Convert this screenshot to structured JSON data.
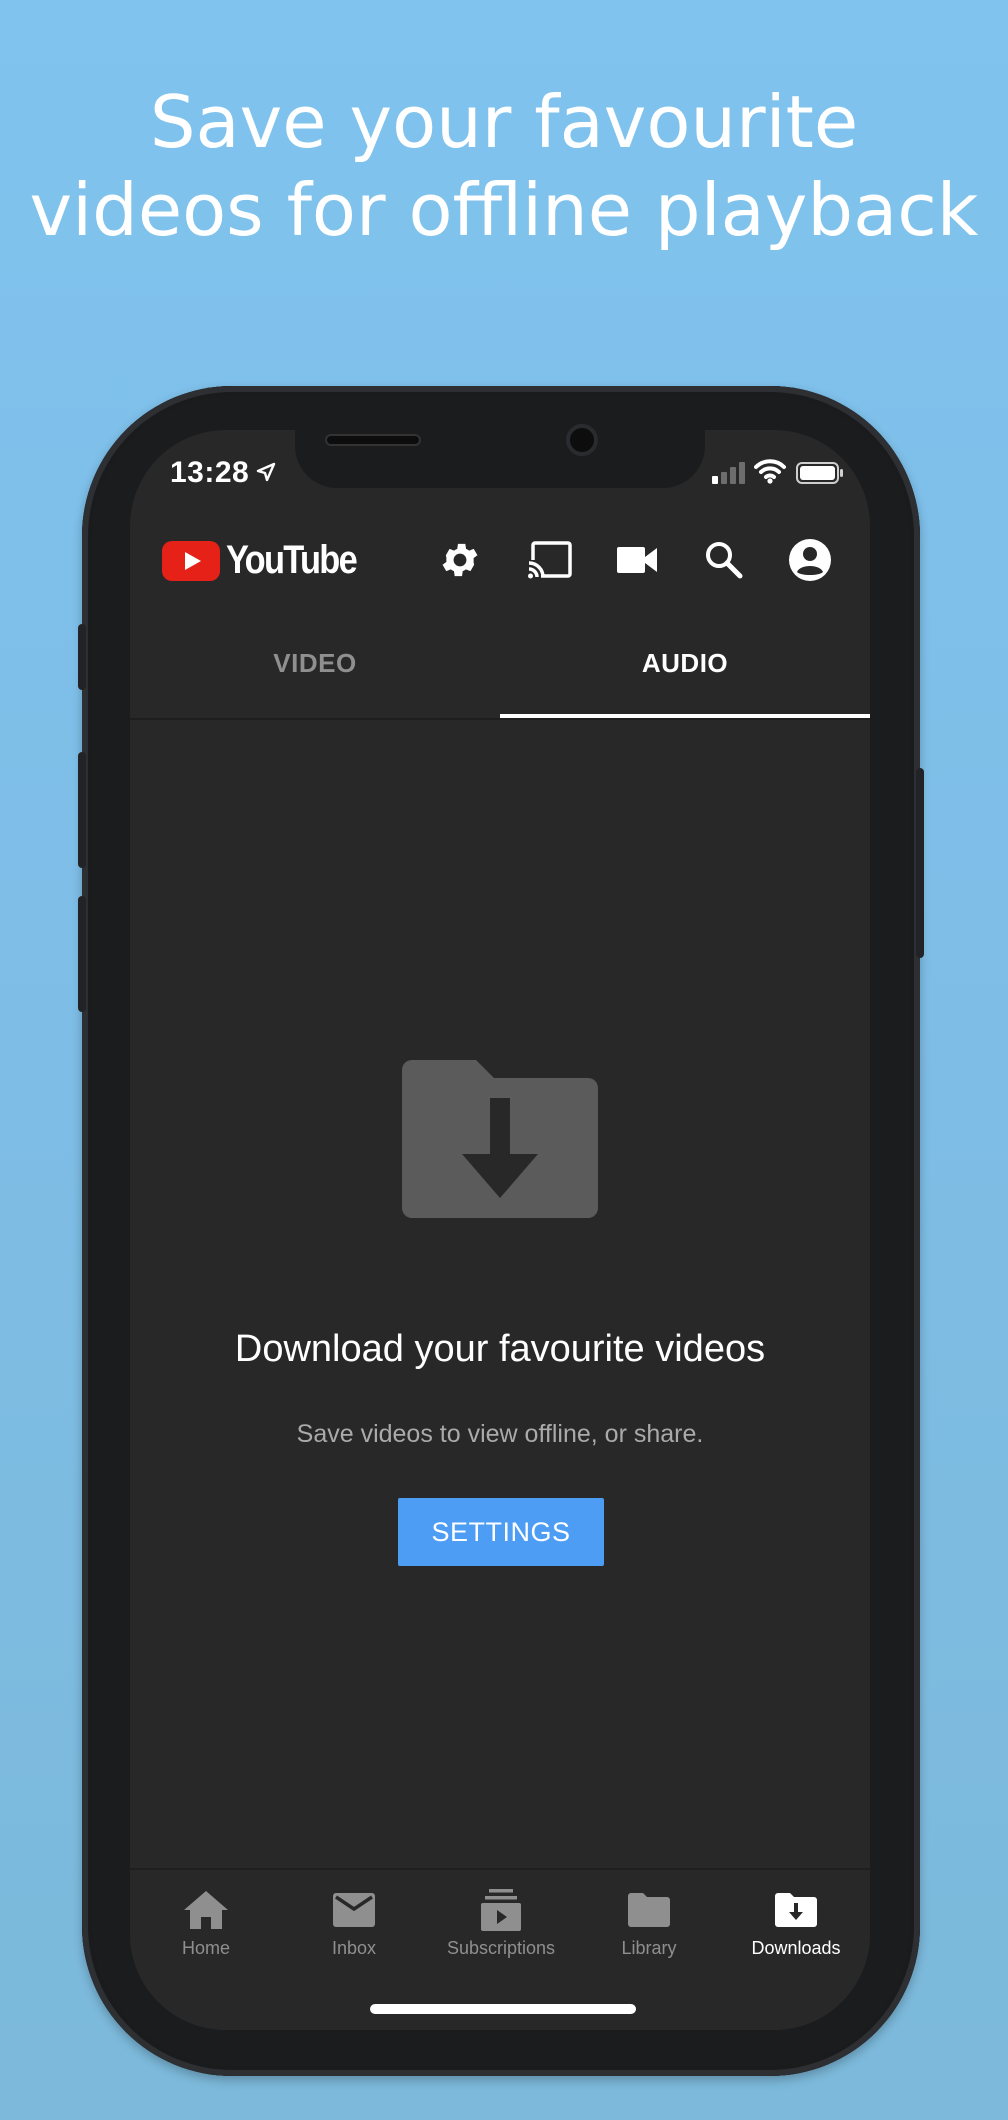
{
  "headline": {
    "line1": "Save your favourite",
    "line2": "videos for offline playback"
  },
  "status_bar": {
    "time": "13:28",
    "icons": [
      "location-arrow-icon",
      "cellular-signal-icon",
      "wifi-icon",
      "battery-icon"
    ]
  },
  "app_header": {
    "logo_text": "YouTube",
    "icons": [
      "settings-gear-icon",
      "cast-icon",
      "video-camera-icon",
      "search-icon",
      "account-icon"
    ]
  },
  "tabs": [
    {
      "label": "VIDEO",
      "active": false
    },
    {
      "label": "AUDIO",
      "active": true
    }
  ],
  "empty_state": {
    "icon": "download-folder-icon",
    "title": "Download your favourite videos",
    "subtitle": "Save videos to view offline, or share.",
    "button_label": "SETTINGS"
  },
  "bottom_nav": [
    {
      "label": "Home",
      "icon": "home-icon",
      "active": false
    },
    {
      "label": "Inbox",
      "icon": "mail-icon",
      "active": false
    },
    {
      "label": "Subscriptions",
      "icon": "subscriptions-icon",
      "active": false
    },
    {
      "label": "Library",
      "icon": "folder-icon",
      "active": false
    },
    {
      "label": "Downloads",
      "icon": "download-folder-icon",
      "active": true
    }
  ],
  "colors": {
    "background": "#7fc3ee",
    "screen": "#282828",
    "accent_button": "#4d9df5",
    "youtube_red": "#e62117",
    "inactive_text": "#8f8f8f"
  }
}
